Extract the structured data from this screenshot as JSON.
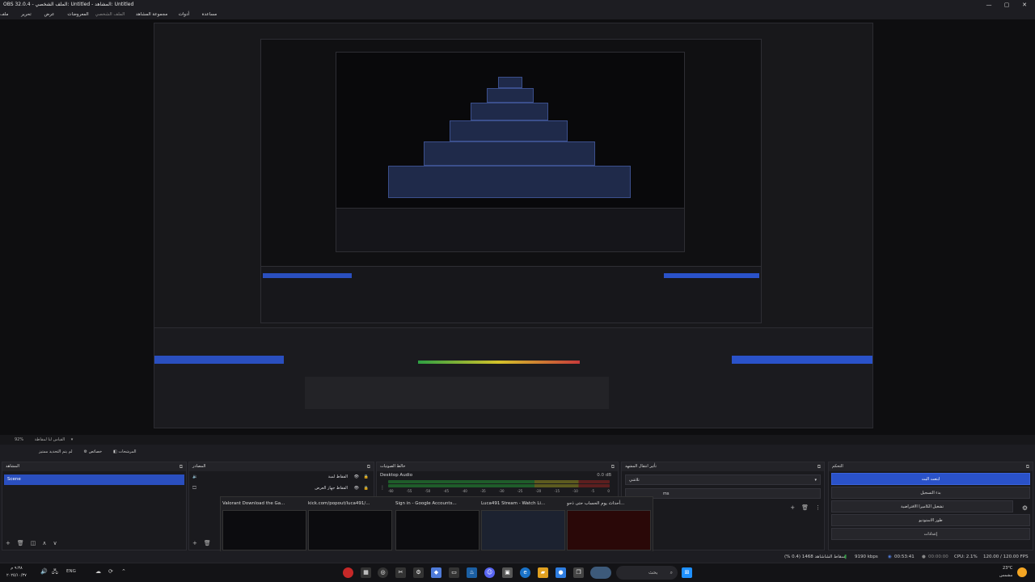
{
  "window": {
    "title": "OBS 32.0.4 - الملف الشخصي: Untitled - المشاهد: Untitled",
    "controls": [
      "—",
      "▢",
      "✕"
    ]
  },
  "menu": [
    "مساعدة (H)",
    "أدوات (T)",
    "مجموعة المشاهد (S)",
    "الملف الشخصي (P)",
    "المعروضات",
    "عرض (V)",
    "تحرير (E)",
    "ملف (F)"
  ],
  "preview_status": {
    "zoom": "92%",
    "lock_label": "القياس لنا لمقاطة"
  },
  "toolbar": {
    "studio_mode": "لم يتم التحديد ممتيز",
    "properties": "خصائص",
    "filters": "المرشحات"
  },
  "docks": {
    "scenes": {
      "title": "المشاهد",
      "items": [
        "Scene"
      ]
    },
    "sources": {
      "title": "المصادر",
      "items": [
        "الفقاط لمبة",
        "الفقاط جهاز العرض"
      ]
    },
    "mixer": {
      "title": "خالط الصوتيات",
      "channel": "Desktop Audio",
      "level": "0.0 dB",
      "ticks": [
        "-60",
        "-55",
        "-50",
        "-45",
        "-40",
        "-35",
        "-30",
        "-25",
        "-20",
        "-15",
        "-10",
        "-5",
        "0"
      ]
    },
    "transitions": {
      "title": "تأثير انتقال المشهد",
      "value": "تلاشي",
      "duration": "ms"
    },
    "controls": {
      "title": "التحكم",
      "buttons": [
        "ابتعث البث",
        "بدء التسجيل",
        "تشغيل الكاميرا الافتراضية",
        "طور الاستوديو",
        "إعدادات"
      ]
    }
  },
  "thumbnails": [
    {
      "title": "Valorant Download the Ga..."
    },
    {
      "title": "kick.com/popout/luca491/..."
    },
    {
      "title": "Sign in - Google Accounts..."
    },
    {
      "title": "Luca491 Stream - Watch Li..."
    },
    {
      "title": "أحداث يوم الحساب حتى ذحو..."
    }
  ],
  "status": {
    "dropped": "إسقاط الشاشاهد 1468 (0.4 %)",
    "bitrate": "9190 kbps",
    "live": "00:53:41",
    "rec": "00:00:00",
    "cpu": "CPU: 2.1%",
    "fps": "120.00 / 120.00 FPS"
  },
  "taskbar": {
    "time": "٩:٣٨ م",
    "date": "٢٠٢٥/١٠/٣٧",
    "lang": "ENG",
    "search": "بحث",
    "weather_temp": "23°C",
    "weather_desc": "مشمس"
  },
  "colors": {
    "accent": "#2a52c9",
    "bg": "#1d1d22",
    "panel": "#1a1a1e"
  }
}
